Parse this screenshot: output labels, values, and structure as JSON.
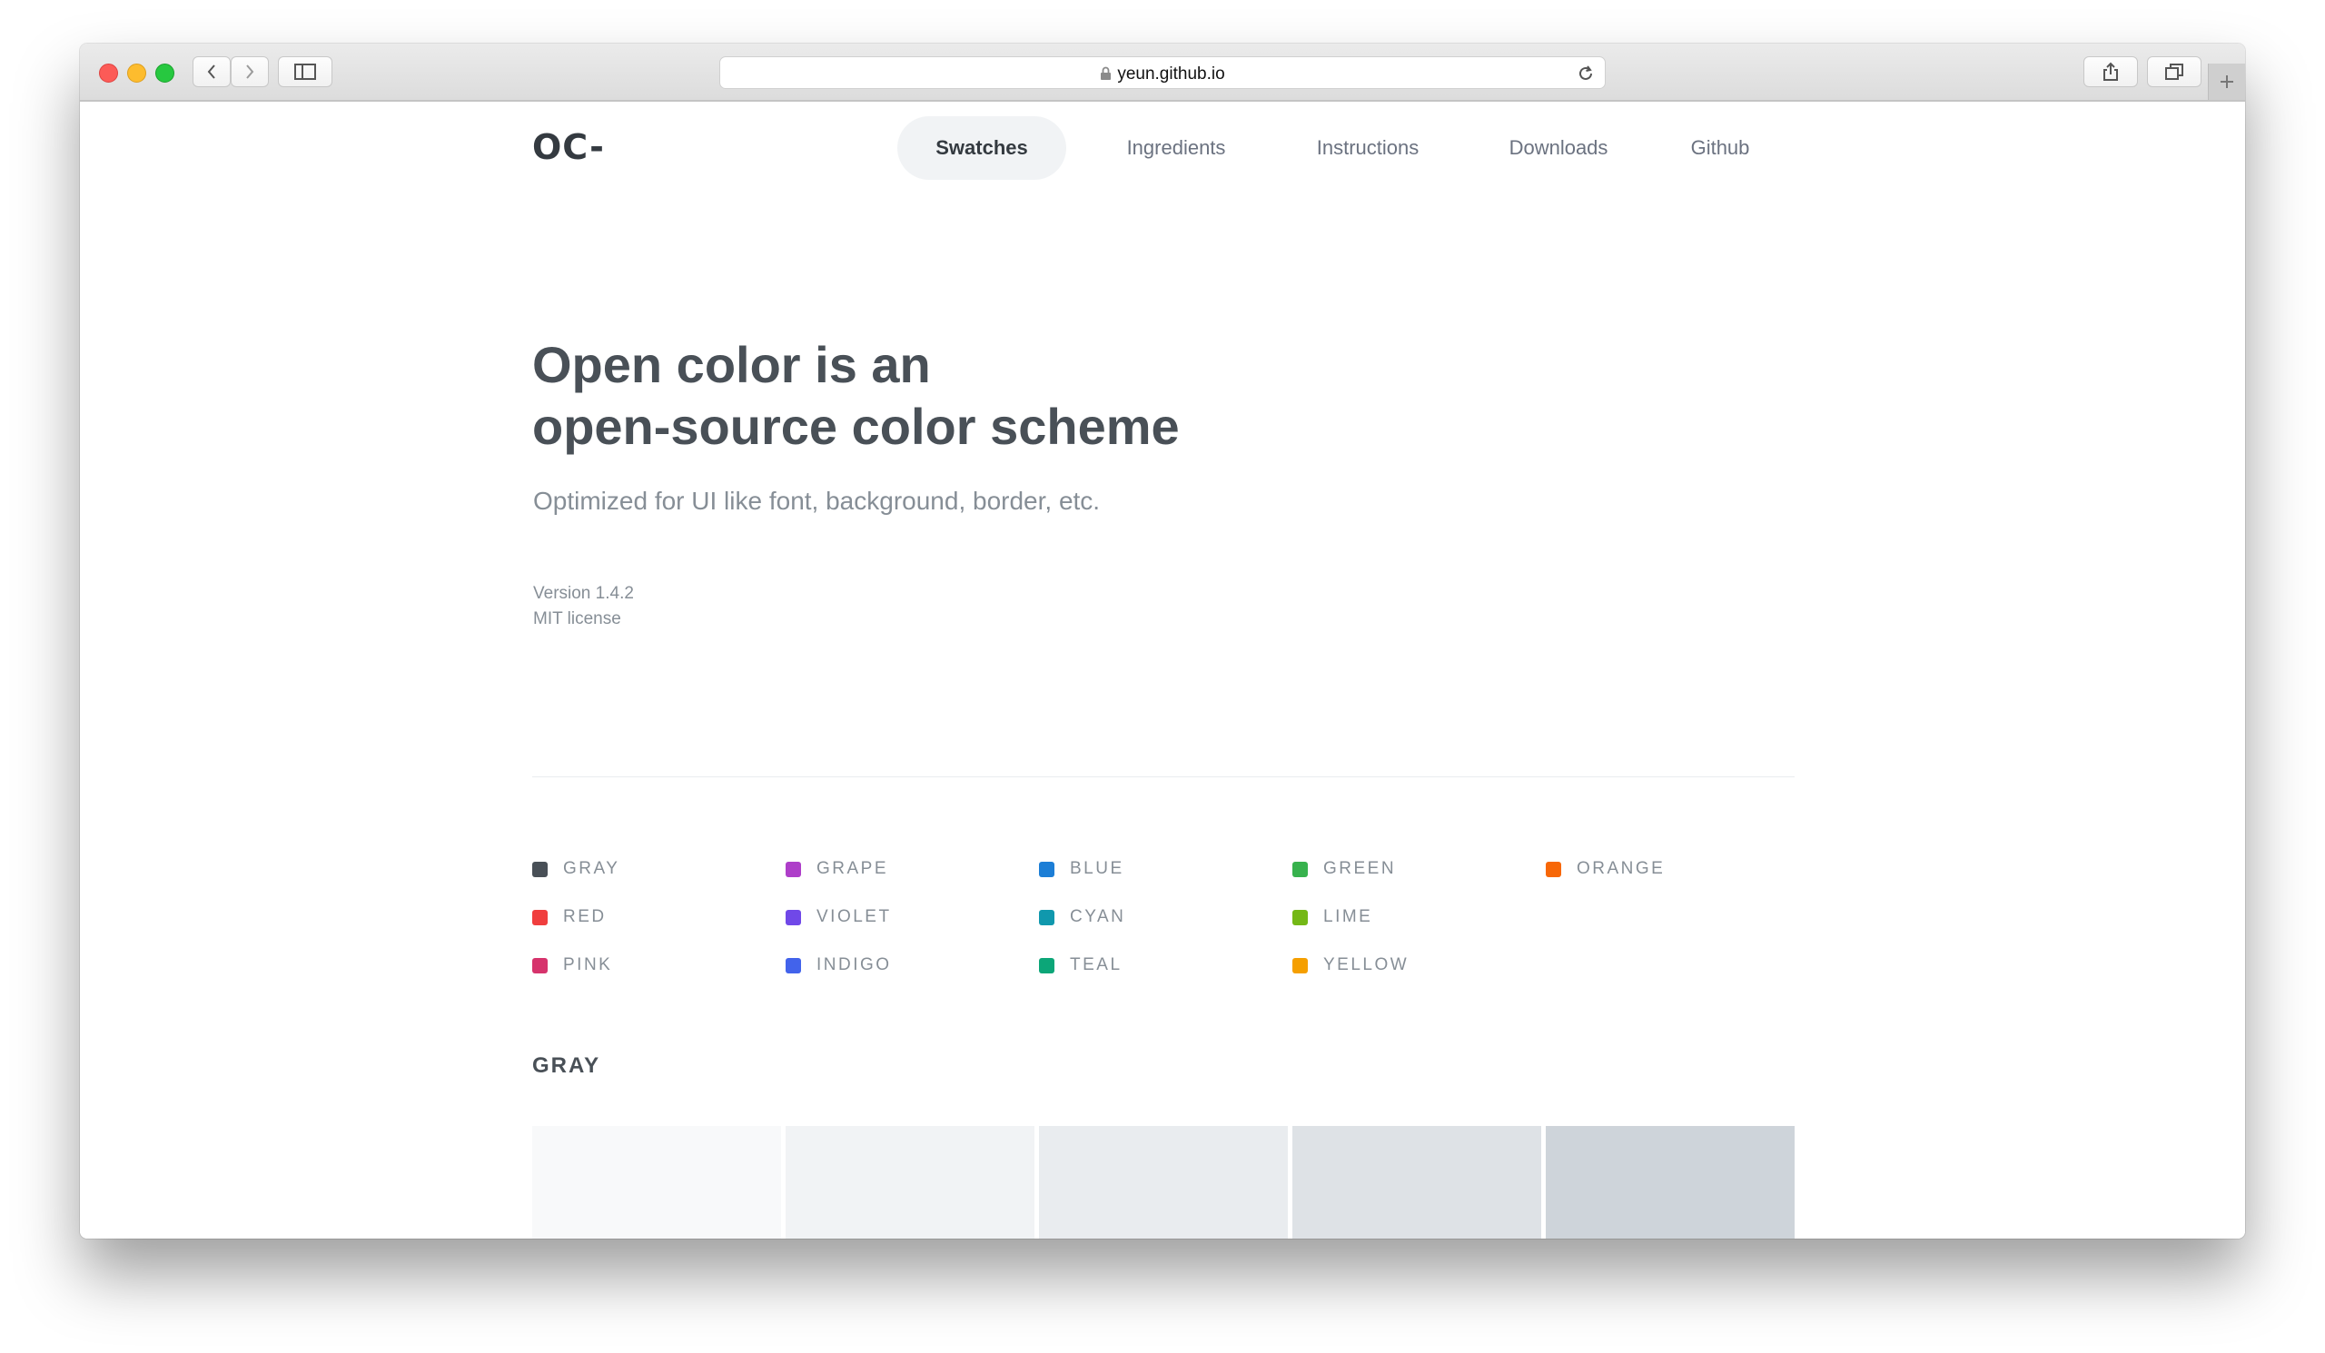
{
  "browser": {
    "url": "yeun.github.io"
  },
  "site": {
    "logo": "OC-",
    "nav": [
      "Swatches",
      "Ingredients",
      "Instructions",
      "Downloads",
      "Github"
    ],
    "active_nav": "Swatches"
  },
  "hero": {
    "title_line1": "Open color is an",
    "title_line2": "open-source color scheme",
    "subtitle": "Optimized for UI like font, background, border, etc.",
    "version": "Version 1.4.2",
    "license": "MIT license"
  },
  "legend": [
    {
      "label": "GRAY",
      "color": "#495057"
    },
    {
      "label": "GRAPE",
      "color": "#ae3ec9"
    },
    {
      "label": "BLUE",
      "color": "#1c7ed6"
    },
    {
      "label": "GREEN",
      "color": "#37b24d"
    },
    {
      "label": "ORANGE",
      "color": "#f76707"
    },
    {
      "label": "RED",
      "color": "#f03e3e"
    },
    {
      "label": "VIOLET",
      "color": "#7048e8"
    },
    {
      "label": "CYAN",
      "color": "#1098ad"
    },
    {
      "label": "LIME",
      "color": "#74b816"
    },
    {
      "label": "PINK",
      "color": "#d6336c"
    },
    {
      "label": "INDIGO",
      "color": "#4263eb"
    },
    {
      "label": "TEAL",
      "color": "#0ca678"
    },
    {
      "label": "YELLOW",
      "color": "#f59f00"
    }
  ],
  "section": {
    "title": "GRAY",
    "swatches": [
      "#f8f9fa",
      "#f1f3f5",
      "#e9ecef",
      "#dee2e6",
      "#ced4da"
    ]
  }
}
